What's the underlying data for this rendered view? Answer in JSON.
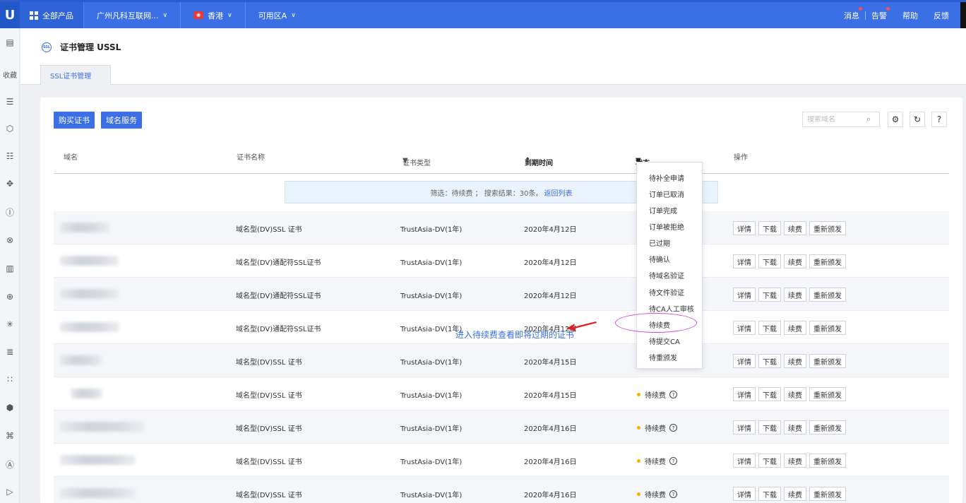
{
  "topbar": {
    "logo": "U",
    "products_label": "全部产品",
    "project_label": "广州凡科互联网...",
    "region_label": "香港",
    "zone_label": "可用区A",
    "right_items": [
      "消息",
      "告警",
      "帮助",
      "反馈"
    ]
  },
  "sidebar": {
    "fav_label": "收藏"
  },
  "page": {
    "icon_text": "SSL",
    "title": "证书管理 USSL",
    "tab_label": "SSL证书管理"
  },
  "toolbar": {
    "buy_label": "购买证书",
    "domain_service_label": "域名服务",
    "search_placeholder": "搜索域名"
  },
  "table": {
    "headers": {
      "domain": "域名",
      "cert_name": "证书名称",
      "cert_type": "证书类型",
      "expire": "到期时间",
      "status": "状态",
      "ops": "操作"
    },
    "filter_text": "筛选：待续费 ； 搜索结果：30条。",
    "filter_link": "返回列表",
    "rows": [
      {
        "name": "域名型(DV)SSL 证书",
        "type": "TrustAsia-DV(1年)",
        "expire": "2020年4月12日",
        "status": ""
      },
      {
        "name": "域名型(DV)通配符SSL证书",
        "type": "TrustAsia-DV(1年)",
        "expire": "2020年4月12日",
        "status": ""
      },
      {
        "name": "域名型(DV)通配符SSL证书",
        "type": "TrustAsia-DV(1年)",
        "expire": "2020年4月12日",
        "status": ""
      },
      {
        "name": "域名型(DV)通配符SSL证书",
        "type": "TrustAsia-DV(1年)",
        "expire": "2020年4月12日",
        "status": ""
      },
      {
        "name": "域名型(DV)SSL 证书",
        "type": "TrustAsia-DV(1年)",
        "expire": "2020年4月15日",
        "status": ""
      },
      {
        "name": "域名型(DV)SSL 证书",
        "type": "TrustAsia-DV(1年)",
        "expire": "2020年4月15日",
        "status": "待续费"
      },
      {
        "name": "域名型(DV)SSL 证书",
        "type": "TrustAsia-DV(1年)",
        "expire": "2020年4月16日",
        "status": "待续费"
      },
      {
        "name": "域名型(DV)SSL 证书",
        "type": "TrustAsia-DV(1年)",
        "expire": "2020年4月16日",
        "status": "待续费"
      },
      {
        "name": "域名型(DV)SSL 证书",
        "type": "TrustAsia-DV(1年)",
        "expire": "2020年4月16日",
        "status": "待续费"
      }
    ],
    "ops": [
      "详情",
      "下载",
      "续费",
      "重新颁发"
    ]
  },
  "status_dropdown": {
    "options": [
      "待补全申请",
      "订单已取消",
      "订单完成",
      "订单被拒绝",
      "已过期",
      "待确认",
      "待域名验证",
      "待文件验证",
      "待CA人工审核",
      "待续费",
      "待提交CA",
      "待重颁发"
    ]
  },
  "annotation": {
    "text": "进入待续费查看即将过期的证书"
  },
  "colors": {
    "primary": "#3a6fe6",
    "status_dot": "#f5b000",
    "highlight": "#d04bd6"
  }
}
